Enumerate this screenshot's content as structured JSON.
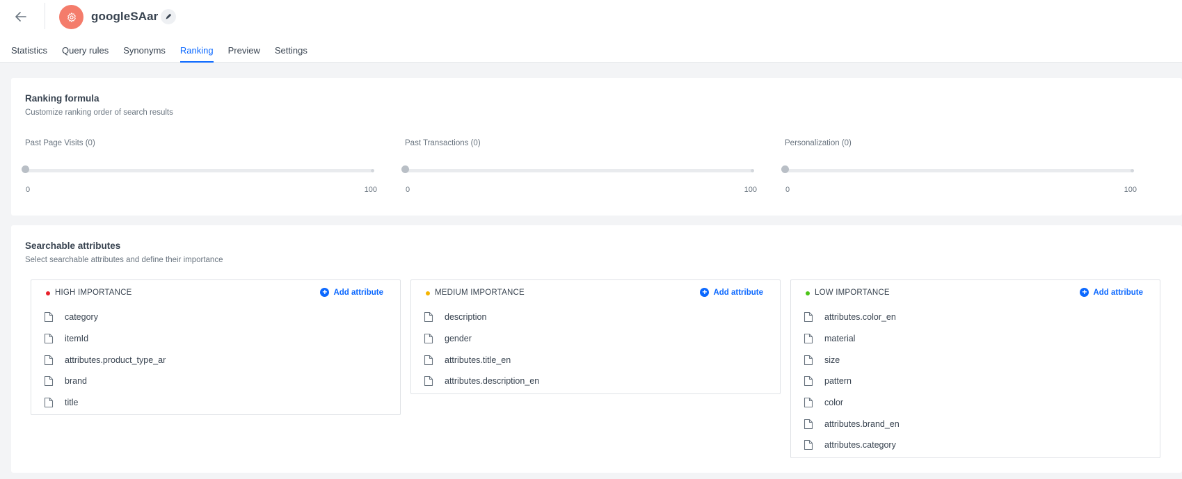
{
  "header": {
    "title": "googleSAar",
    "icons": {
      "back": "arrow-left-icon",
      "app": "gear-icon",
      "edit": "pencil-icon"
    }
  },
  "tabs": [
    {
      "label": "Statistics",
      "active": false
    },
    {
      "label": "Query rules",
      "active": false
    },
    {
      "label": "Synonyms",
      "active": false
    },
    {
      "label": "Ranking",
      "active": true
    },
    {
      "label": "Preview",
      "active": false
    },
    {
      "label": "Settings",
      "active": false
    }
  ],
  "ranking": {
    "title": "Ranking formula",
    "subtitle": "Customize ranking order of search results",
    "sliders": [
      {
        "label": "Past Page Visits (0)",
        "min": "0",
        "max": "100",
        "value": 0
      },
      {
        "label": "Past Transactions (0)",
        "min": "0",
        "max": "100",
        "value": 0
      },
      {
        "label": "Personalization (0)",
        "min": "0",
        "max": "100",
        "value": 0
      }
    ]
  },
  "attributes": {
    "title": "Searchable attributes",
    "subtitle": "Select searchable attributes and define their importance",
    "add_label": "Add attribute",
    "groups": [
      {
        "label": "HIGH IMPORTANCE",
        "color": "#e8202a",
        "items": [
          "category",
          "itemId",
          "attributes.product_type_ar",
          "brand",
          "title"
        ]
      },
      {
        "label": "MEDIUM IMPORTANCE",
        "color": "#f5b400",
        "items": [
          "description",
          "gender",
          "attributes.title_en",
          "attributes.description_en"
        ]
      },
      {
        "label": "LOW IMPORTANCE",
        "color": "#4cc417",
        "items": [
          "attributes.color_en",
          "material",
          "size",
          "pattern",
          "color",
          "attributes.brand_en",
          "attributes.category"
        ]
      }
    ]
  },
  "colors": {
    "accent": "#0b68ff",
    "app_icon": "#f47c6b"
  }
}
